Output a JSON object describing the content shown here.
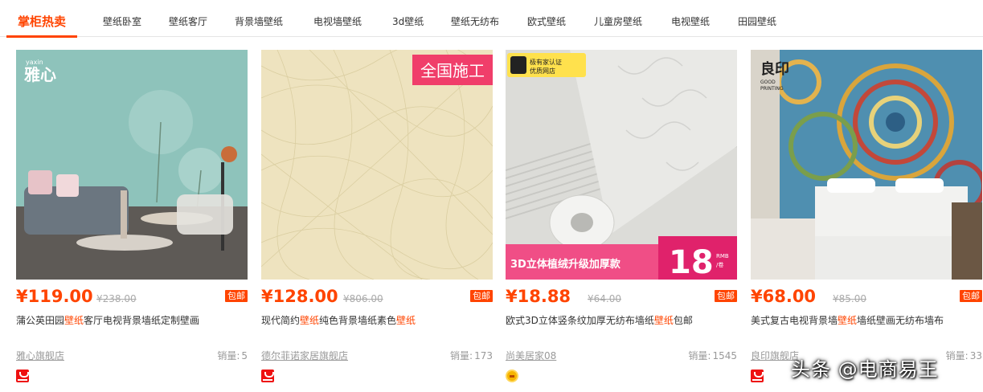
{
  "tabs": [
    {
      "label": "掌柜热卖",
      "active": true
    },
    {
      "label": "壁纸卧室"
    },
    {
      "label": "壁纸客厅"
    },
    {
      "label": "背景墙壁纸"
    },
    {
      "label": "电视墙壁纸"
    },
    {
      "label": "3d壁纸"
    },
    {
      "label": "壁纸无纺布"
    },
    {
      "label": "欧式壁纸"
    },
    {
      "label": "儿童房壁纸"
    },
    {
      "label": "电视壁纸"
    },
    {
      "label": "田园壁纸"
    }
  ],
  "products": [
    {
      "brand_logo": "yaxin",
      "brand_name": "雅心",
      "price": "¥119.00",
      "old_price": "¥238.00",
      "badge": "包邮",
      "title_pre": "蒲公英田园",
      "title_hl": "壁纸",
      "title_post": "客厅电视背景墙纸定制壁画",
      "shop": "雅心旗舰店",
      "sales_label": "销量:",
      "sales": "5",
      "shop_icon": "tmall-icon"
    },
    {
      "overlay_tag": "全国施工",
      "price": "¥128.00",
      "old_price": "¥806.00",
      "badge": "包邮",
      "title_pre": "现代简约",
      "title_hl": "壁纸",
      "title_post": "纯色背景墙纸素色",
      "title_hl2": "壁纸",
      "shop": "德尔菲诺家居旗舰店",
      "sales_label": "销量:",
      "sales": "173",
      "shop_icon": "tmall-icon"
    },
    {
      "cert_line1": "极有家认证",
      "cert_line2": "优质网店",
      "banner_text": "3D立体植绒升级加厚款",
      "banner_price": "18",
      "banner_unit1": "RMB",
      "banner_unit2": "/卷",
      "price": "¥18.88",
      "old_price": "¥64.00",
      "badge": "包邮",
      "title_pre": "欧式3D立体竖条纹加厚无纺布墙纸",
      "title_hl": "壁纸",
      "title_post": "包邮",
      "shop": "尚美居家08",
      "sales_label": "销量:",
      "sales": "1545",
      "shop_icon": "gold-crown-icon"
    },
    {
      "brand_name": "良印",
      "brand_sub1": "GOOD",
      "brand_sub2": "PRINTING",
      "price": "¥68.00",
      "old_price": "¥85.00",
      "badge": "包邮",
      "title_pre": "美式复古电视背景墙",
      "title_hl": "壁纸",
      "title_post": "墙纸壁画无纺布墙布",
      "shop": "良印旗舰店",
      "sales_label": "销量:",
      "sales": "33",
      "shop_icon": "tmall-icon"
    }
  ],
  "watermark": "头条 @电商易王",
  "colors": {
    "accent": "#ff4400",
    "badge": "#ff4400",
    "tab_underline": "#ff4400"
  }
}
